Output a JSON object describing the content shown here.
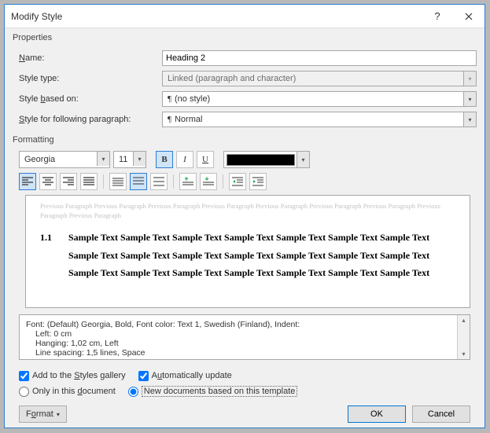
{
  "titlebar": {
    "title": "Modify Style"
  },
  "properties": {
    "heading": "Properties",
    "name_label_pre": "",
    "name_label_u": "N",
    "name_label_post": "ame:",
    "name_value": "Heading 2",
    "styletype_label": "Style type:",
    "styletype_value": "Linked (paragraph and character)",
    "basedon_label_pre": "Style ",
    "basedon_label_u": "b",
    "basedon_label_post": "ased on:",
    "basedon_value": "(no style)",
    "following_label_pre": "",
    "following_label_u": "S",
    "following_label_post": "tyle for following paragraph:",
    "following_value": "Normal",
    "pilcrow": "¶"
  },
  "formatting": {
    "heading": "Formatting",
    "font": "Georgia",
    "size": "11",
    "bold": "B",
    "italic": "I",
    "underline": "U"
  },
  "preview": {
    "ghost": "Previous Paragraph Previous Paragraph Previous Paragraph Previous Paragraph Previous Paragraph Previous Paragraph Previous Paragraph Previous Paragraph Previous Paragraph",
    "num": "1.1",
    "sample": "Sample Text Sample Text Sample Text Sample Text Sample Text Sample Text Sample Text Sample Text Sample Text Sample Text Sample Text Sample Text Sample Text Sample Text Sample Text Sample Text Sample Text Sample Text Sample Text Sample Text Sample Text"
  },
  "desc": {
    "l1": "Font: (Default) Georgia, Bold, Font color: Text 1, Swedish (Finland), Indent:",
    "l2": "Left:  0 cm",
    "l3": "Hanging:  1,02 cm, Left",
    "l4": "Line spacing:  1,5 lines, Space"
  },
  "opts": {
    "add_pre": "Add to the ",
    "add_u": "S",
    "add_post": "tyles gallery",
    "auto_pre": "A",
    "auto_u": "u",
    "auto_post": "tomatically update",
    "only_pre": "Only in this ",
    "only_u": "d",
    "only_post": "ocument",
    "newdoc": "New documents based on this template"
  },
  "footer": {
    "format_pre": "F",
    "format_u": "o",
    "format_post": "rmat",
    "ok": "OK",
    "cancel": "Cancel"
  }
}
